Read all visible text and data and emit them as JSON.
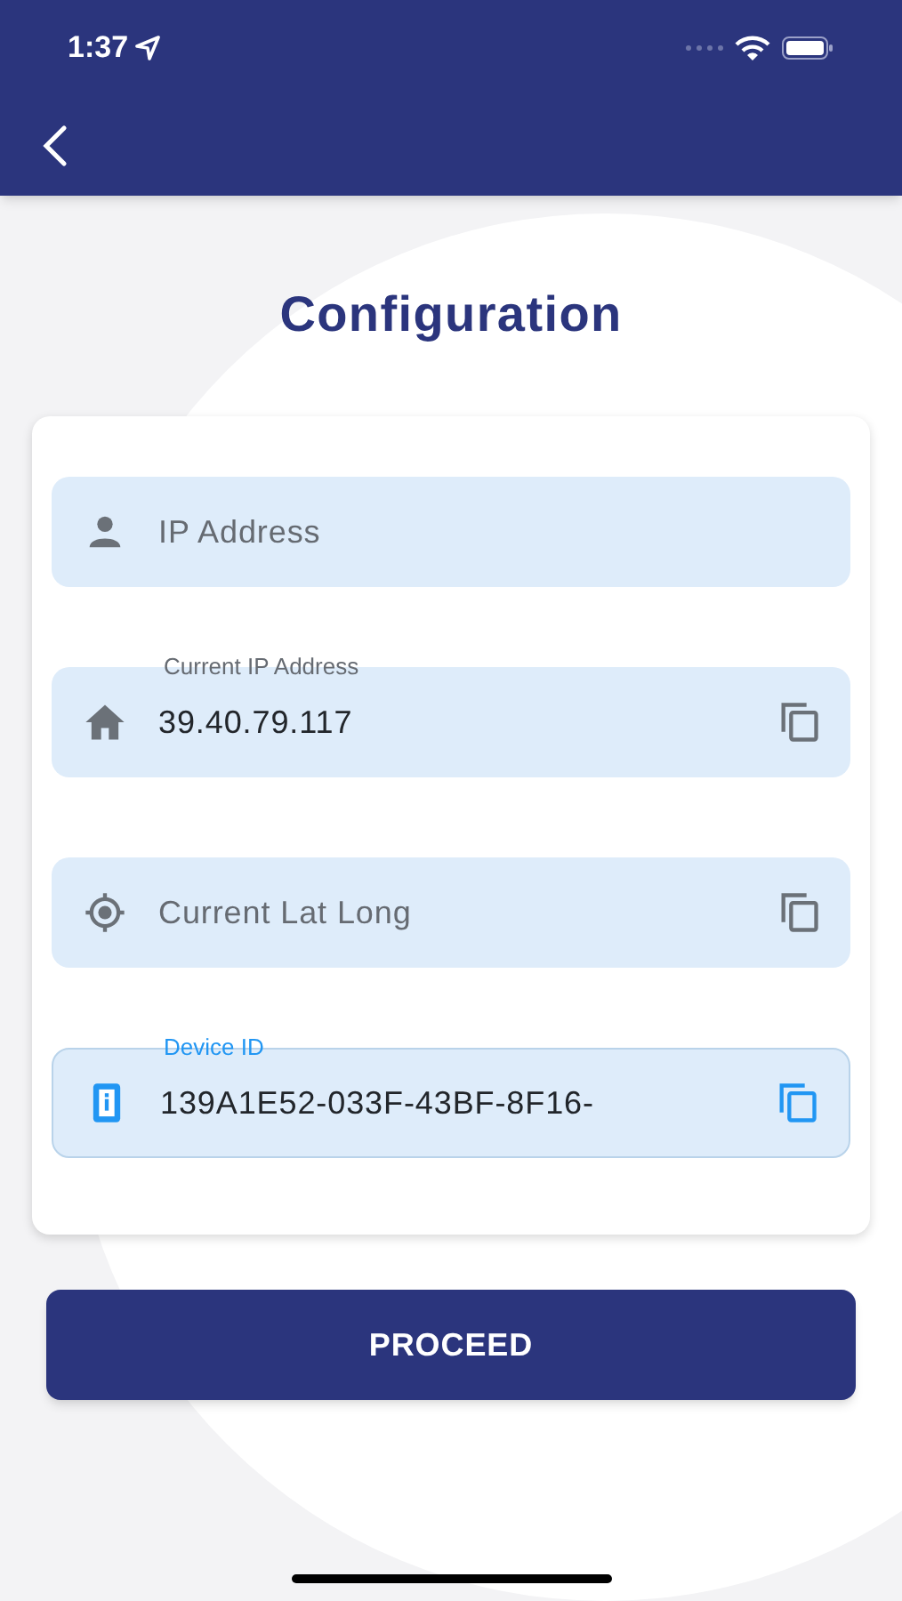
{
  "status_bar": {
    "time": "1:37"
  },
  "title": "Configuration",
  "fields": [
    {
      "kind": "person",
      "placeholder": "IP Address",
      "copy": false,
      "focused": false
    },
    {
      "kind": "home",
      "label": "Current IP Address",
      "value": "39.40.79.117",
      "copy": true,
      "focused": false
    },
    {
      "kind": "target",
      "placeholder": "Current Lat Long",
      "copy": true,
      "focused": false
    },
    {
      "kind": "info",
      "label": "Device ID",
      "value": "139A1E52-033F-43BF-8F16-",
      "copy": true,
      "focused": true
    }
  ],
  "button": "PROCEED"
}
